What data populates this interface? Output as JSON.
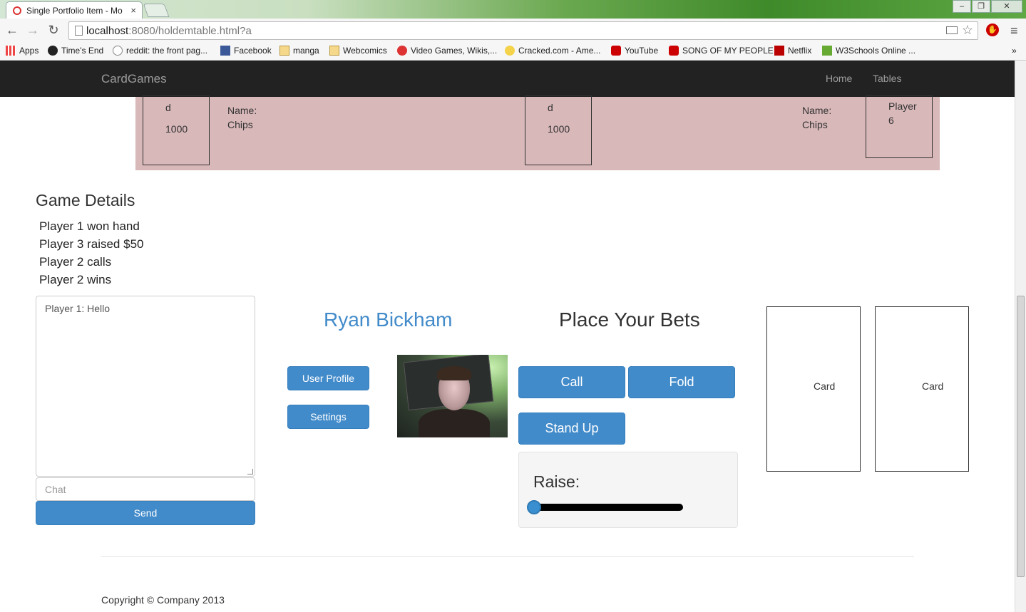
{
  "browser": {
    "tab_title": "Single Portfolio Item - Mo",
    "url_host": "localhost",
    "url_rest": ":8080/holdemtable.html?a",
    "bookmarks": [
      {
        "label": "Apps",
        "icon": "apps-grid-icon"
      },
      {
        "label": "Time's End",
        "icon": "cat-icon"
      },
      {
        "label": "reddit: the front pag...",
        "icon": "reddit-icon"
      },
      {
        "label": "Facebook",
        "icon": "facebook-icon"
      },
      {
        "label": "manga",
        "icon": "folder-icon"
      },
      {
        "label": "Webcomics",
        "icon": "folder-icon"
      },
      {
        "label": "Video Games, Wikis,...",
        "icon": "wikia-icon"
      },
      {
        "label": "Cracked.com - Ame...",
        "icon": "cracked-icon"
      },
      {
        "label": "YouTube",
        "icon": "youtube-icon"
      },
      {
        "label": "SONG OF MY PEOPLE",
        "icon": "youtube-icon"
      },
      {
        "label": "Netflix",
        "icon": "netflix-icon"
      },
      {
        "label": "W3Schools Online ...",
        "icon": "w3schools-icon"
      }
    ],
    "overflow": "»"
  },
  "navbar": {
    "brand": "CardGames",
    "links": [
      "Home",
      "Tables"
    ]
  },
  "table": {
    "seats": [
      {
        "a": "d",
        "b": "1000"
      },
      {
        "a": "d",
        "b": "1000"
      },
      {
        "a": "Player",
        "b": "6"
      }
    ],
    "info_left": {
      "name": "Name:",
      "chips": "Chips"
    },
    "info_right": {
      "name": "Name:",
      "chips": "Chips"
    }
  },
  "game_details": {
    "title": "Game Details",
    "lines": [
      "Player 1 won hand",
      "Player 3 raised $50",
      "Player 2 calls",
      "Player 2 wins"
    ]
  },
  "chat": {
    "log": "Player 1: Hello",
    "placeholder": "Chat",
    "send_label": "Send"
  },
  "player": {
    "name": "Ryan Bickham",
    "profile_label": "User Profile",
    "settings_label": "Settings"
  },
  "bets": {
    "title": "Place Your Bets",
    "call_label": "Call",
    "fold_label": "Fold",
    "stand_label": "Stand Up",
    "raise_label": "Raise:",
    "raise_value": 0
  },
  "cards": [
    "Card",
    "Card"
  ],
  "footer": {
    "copyright": "Copyright © Company 2013"
  },
  "colors": {
    "accent": "#428bca",
    "table": "#d9b8b9",
    "navbar": "#222222"
  }
}
